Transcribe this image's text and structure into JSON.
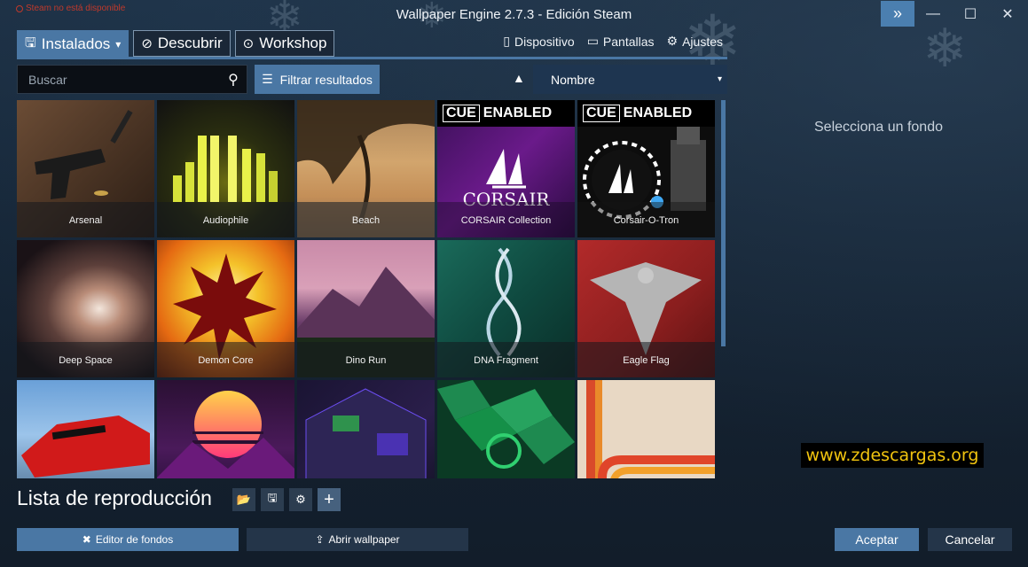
{
  "window": {
    "title": "Wallpaper Engine 2.7.3 - Edición Steam",
    "steam_status": "Steam no está disponible",
    "expand_glyph": "»",
    "minimize_glyph": "—",
    "maximize_glyph": "☐",
    "close_glyph": "✕"
  },
  "tabs": [
    {
      "label": "Instalados",
      "icon": "floppy-icon",
      "glyph": "🖫",
      "caret": "▾"
    },
    {
      "label": "Descubrir",
      "icon": "compass-icon",
      "glyph": "⊘"
    },
    {
      "label": "Workshop",
      "icon": "steam-icon",
      "glyph": "⊙"
    }
  ],
  "top_actions": [
    {
      "label": "Dispositivo",
      "icon": "phone-icon",
      "glyph": "▯"
    },
    {
      "label": "Pantallas",
      "icon": "monitor-icon",
      "glyph": "▭"
    },
    {
      "label": "Ajustes",
      "icon": "gear-icon",
      "glyph": "⚙"
    }
  ],
  "search": {
    "placeholder": "Buscar",
    "value": "",
    "icon_glyph": "⚲"
  },
  "filter": {
    "label": "Filtrar resultados",
    "glyph": "☰"
  },
  "sort": {
    "direction_glyph": "▲",
    "selected": "Nombre",
    "caret": "▾"
  },
  "wallpapers": [
    {
      "name": "Arsenal"
    },
    {
      "name": "Audiophile"
    },
    {
      "name": "Beach"
    },
    {
      "name": "CORSAIR Collection"
    },
    {
      "name": "Corsair-O-Tron"
    },
    {
      "name": "Deep Space"
    },
    {
      "name": "Demon Core"
    },
    {
      "name": "Dino Run"
    },
    {
      "name": "DNA Fragment"
    },
    {
      "name": "Eagle Flag"
    },
    {
      "name": ""
    },
    {
      "name": ""
    },
    {
      "name": ""
    },
    {
      "name": ""
    },
    {
      "name": ""
    }
  ],
  "cue_badge": {
    "prefix": "CUE",
    "suffix": "ENABLED",
    "brand": "CORSAIR"
  },
  "right_panel": {
    "prompt": "Selecciona un fondo"
  },
  "watermark": "www.zdescargas.org",
  "playlist": {
    "title": "Lista de reproducción",
    "buttons": [
      {
        "icon": "folder-icon",
        "glyph": "📂"
      },
      {
        "icon": "save-icon",
        "glyph": "🖫"
      },
      {
        "icon": "settings-icon",
        "glyph": "⚙"
      },
      {
        "icon": "plus-icon",
        "glyph": "+"
      }
    ]
  },
  "bottom": {
    "editor": {
      "label": "Editor de fondos",
      "glyph": "✖"
    },
    "open": {
      "label": "Abrir wallpaper",
      "glyph": "⇪"
    },
    "accept": "Aceptar",
    "cancel": "Cancelar"
  },
  "colors": {
    "accent": "#4a77a4",
    "background": "#14202e",
    "watermark_text": "#f1c40f"
  }
}
